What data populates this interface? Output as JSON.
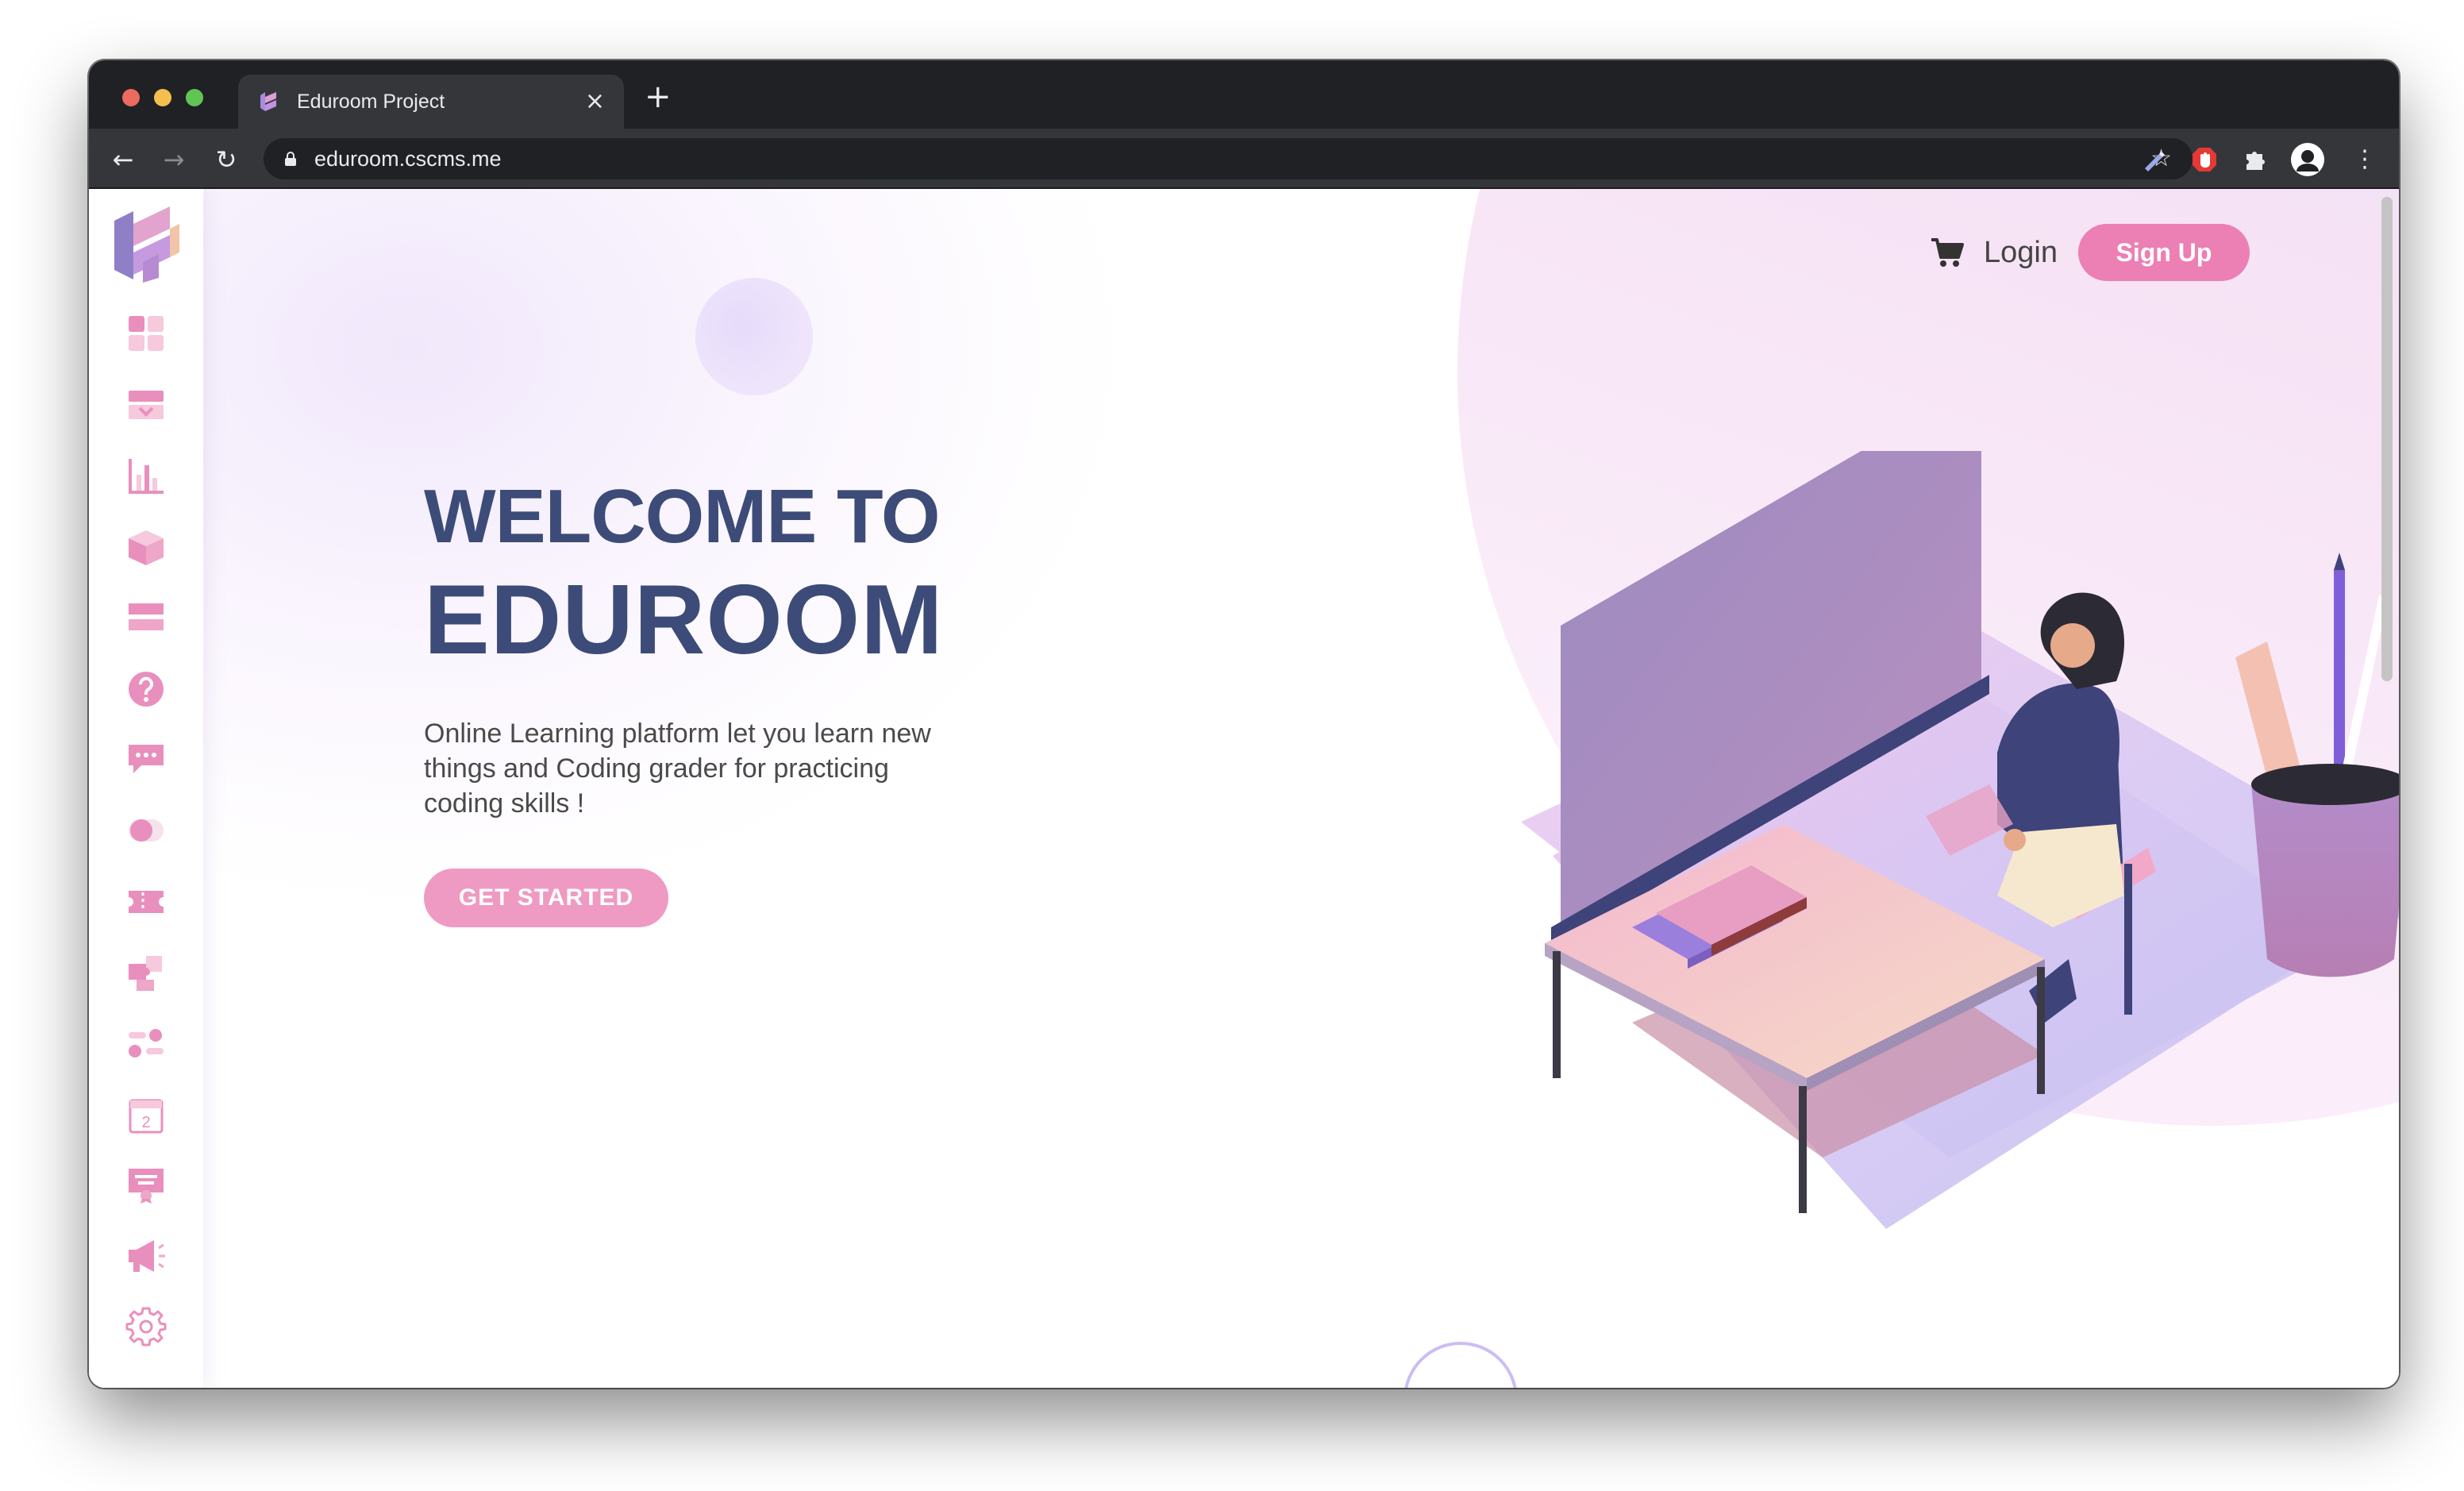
{
  "browser": {
    "tab_title": "Eduroom Project",
    "tab_close": "×",
    "new_tab": "+",
    "url": "eduroom.cscms.me",
    "nav": {
      "back": "←",
      "forward": "→",
      "reload": "↻",
      "star": "☆",
      "menu": "⋮"
    }
  },
  "header": {
    "login_label": "Login",
    "signup_label": "Sign Up"
  },
  "hero": {
    "line1": "WELCOME TO",
    "line2": "EDUROOM",
    "subtitle": "Online Learning platform let you learn new things and Coding grader for practicing coding skills !",
    "cta_label": "GET STARTED"
  },
  "sidebar": {
    "items": [
      {
        "icon": "dashboard-icon"
      },
      {
        "icon": "inbox-icon"
      },
      {
        "icon": "bar-chart-icon"
      },
      {
        "icon": "cube-icon"
      },
      {
        "icon": "list-icon"
      },
      {
        "icon": "help-icon"
      },
      {
        "icon": "chat-icon"
      },
      {
        "icon": "toggle-icon"
      },
      {
        "icon": "ticket-icon"
      },
      {
        "icon": "puzzle-icon"
      },
      {
        "icon": "settings-toggle-icon"
      },
      {
        "icon": "calendar-icon",
        "text": "2"
      },
      {
        "icon": "certificate-icon"
      },
      {
        "icon": "megaphone-icon"
      },
      {
        "icon": "gear-icon"
      }
    ]
  },
  "colors": {
    "accent_pink": "#ec7fb4",
    "heading_navy": "#3d4b78",
    "icon_pink": "#e98fbd"
  }
}
